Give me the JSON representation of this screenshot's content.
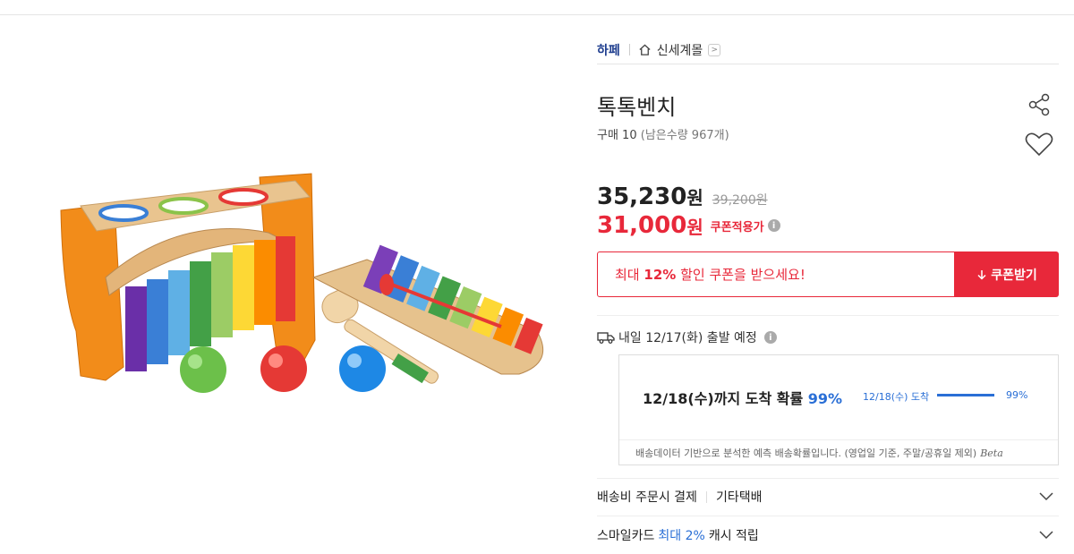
{
  "breadcrumb": {
    "site": "하페",
    "store": "신세계몰",
    "store_arrow": ">"
  },
  "product": {
    "title": "톡톡벤치",
    "purchase_label": "구매 10",
    "remaining": "(남은수량 967개)"
  },
  "price": {
    "sale": "35,230",
    "sale_unit": "원",
    "original": "39,200원",
    "coupon_price": "31,000",
    "coupon_unit": "원",
    "coupon_note": "쿠폰적용가",
    "info_icon": "i"
  },
  "coupon": {
    "prefix": "최대",
    "percent": "12%",
    "suffix": "할인 쿠폰을 받으세요!",
    "button_label": "쿠폰받기",
    "button_icon": "download-icon"
  },
  "shipping": {
    "departure": "내일 12/17(화) 출발 예정",
    "info_icon": "i",
    "arrival_text": "12/18(수)까지 도착 확률",
    "arrival_pct": "99%",
    "bar_label": "12/18(수) 도착",
    "bar_pct": "99%",
    "bar_fill": 0.99,
    "footnote": "배송데이터 기반으로 분석한 예측 배송확률입니다. (영업일 기준, 주말/공휴일 제외)",
    "beta": "Beta"
  },
  "rows": {
    "ship_fee": "배송비 주문시 결제",
    "carrier": "기타택배",
    "card_prefix": "스마일카드",
    "card_highlight": "최대 2%",
    "card_suffix": "캐시 적립"
  },
  "colors": {
    "accent_red": "#e8283a",
    "accent_blue": "#2a6fd6",
    "breadcrumb_blue": "#1f3e8f"
  }
}
